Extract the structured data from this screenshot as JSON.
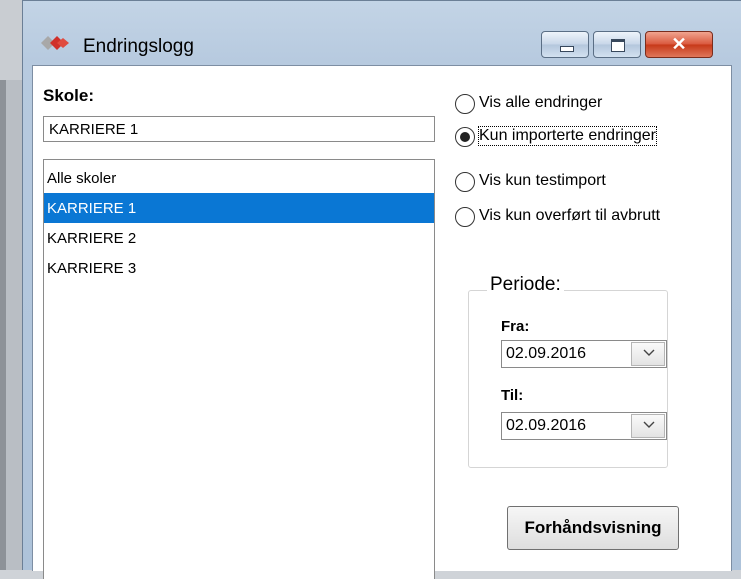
{
  "window": {
    "title": "Endringslogg",
    "close_glyph": "✕"
  },
  "school": {
    "label": "Skole:",
    "input_value": "KARRIERE 1",
    "list_items": [
      "Alle skoler",
      "KARRIERE 1",
      "KARRIERE 2",
      "KARRIERE 3"
    ],
    "selected_index": 1
  },
  "filters": {
    "options": [
      {
        "label": "Vis alle endringer",
        "checked": false
      },
      {
        "label": "Kun importerte endringer",
        "checked": true
      },
      {
        "label": "Vis kun testimport",
        "checked": false
      },
      {
        "label": "Vis kun overført til avbrutt",
        "checked": false
      }
    ]
  },
  "period": {
    "title": "Periode:",
    "from_label": "Fra:",
    "from_value": "02.09.2016",
    "to_label": "Til:",
    "to_value": "02.09.2016",
    "dropdown_icon": "chevron-down-icon"
  },
  "actions": {
    "preview_label": "Forhåndsvisning"
  },
  "colors": {
    "selection": "#0a77d4",
    "close_button": "#c63818",
    "title_bar": "#b7cadf"
  }
}
